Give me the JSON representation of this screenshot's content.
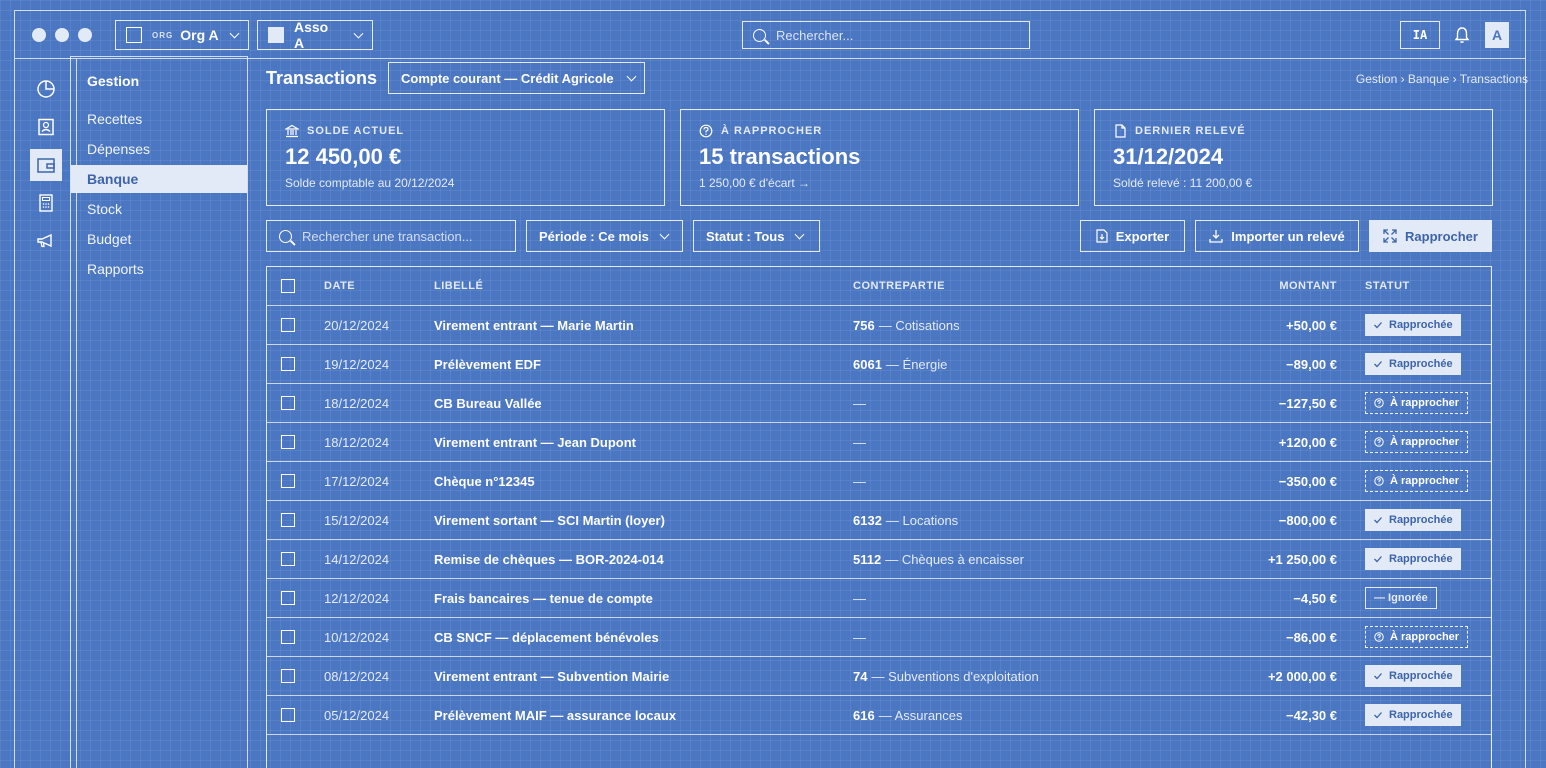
{
  "titlebar": {
    "org_tag": "ORG",
    "org_name": "Org A",
    "asso_name": "Asso A",
    "search_placeholder": "Rechercher...",
    "ia_label": "IA",
    "avatar_letter": "A"
  },
  "rail": {
    "icons": [
      "pie-chart-icon",
      "contact-card-icon",
      "wallet-icon",
      "calculator-icon",
      "megaphone-icon"
    ],
    "active_index": 2
  },
  "submenu": {
    "title": "Gestion",
    "items": [
      "Recettes",
      "Dépenses",
      "Banque",
      "Stock",
      "Budget",
      "Rapports"
    ],
    "active_index": 2
  },
  "header": {
    "title": "Transactions",
    "account": "Compte courant — Crédit Agricole",
    "breadcrumb": "Gestion › Banque › Transactions"
  },
  "cards": [
    {
      "label": "SOLDE ACTUEL",
      "icon": "bank-icon",
      "value": "12 450,00 €",
      "sub": "Solde comptable au 20/12/2024"
    },
    {
      "label": "À RAPPROCHER",
      "icon": "question-circle-icon",
      "value": "15 transactions",
      "sub": "1 250,00 € d'écart →"
    },
    {
      "label": "DERNIER RELEVÉ",
      "icon": "document-icon",
      "value": "31/12/2024",
      "sub": "Soldé relevé : 11 200,00 €"
    }
  ],
  "filters": {
    "search_placeholder": "Rechercher une transaction...",
    "period": "Période : Ce mois",
    "status": "Statut : Tous"
  },
  "actions": {
    "export": "Exporter",
    "import": "Importer un relevé",
    "reconcile": "Rapprocher"
  },
  "table": {
    "headers": {
      "date": "DATE",
      "libelle": "LIBELLÉ",
      "contrepartie": "CONTREPARTIE",
      "montant": "MONTANT",
      "statut": "STATUT"
    },
    "rows": [
      {
        "date": "20/12/2024",
        "libelle": "Virement entrant — Marie Martin",
        "compte": "756",
        "compte_label": "— Cotisations",
        "montant": "+50,00 €",
        "statut": "Rapprochée",
        "kind": "rapprochee"
      },
      {
        "date": "19/12/2024",
        "libelle": "Prélèvement EDF",
        "compte": "6061",
        "compte_label": "— Énergie",
        "montant": "−89,00 €",
        "statut": "Rapprochée",
        "kind": "rapprochee"
      },
      {
        "date": "18/12/2024",
        "libelle": "CB Bureau Vallée",
        "compte": "",
        "compte_label": "—",
        "montant": "−127,50 €",
        "statut": "À rapprocher",
        "kind": "arapprocher"
      },
      {
        "date": "18/12/2024",
        "libelle": "Virement entrant — Jean Dupont",
        "compte": "",
        "compte_label": "—",
        "montant": "+120,00 €",
        "statut": "À rapprocher",
        "kind": "arapprocher"
      },
      {
        "date": "17/12/2024",
        "libelle": "Chèque n°12345",
        "compte": "",
        "compte_label": "—",
        "montant": "−350,00 €",
        "statut": "À rapprocher",
        "kind": "arapprocher"
      },
      {
        "date": "15/12/2024",
        "libelle": "Virement sortant — SCI Martin (loyer)",
        "compte": "6132",
        "compte_label": "— Locations",
        "montant": "−800,00 €",
        "statut": "Rapprochée",
        "kind": "rapprochee"
      },
      {
        "date": "14/12/2024",
        "libelle": "Remise de chèques — BOR-2024-014",
        "compte": "5112",
        "compte_label": "— Chèques à encaisser",
        "montant": "+1 250,00 €",
        "statut": "Rapprochée",
        "kind": "rapprochee"
      },
      {
        "date": "12/12/2024",
        "libelle": "Frais bancaires — tenue de compte",
        "compte": "",
        "compte_label": "—",
        "montant": "−4,50 €",
        "statut": "— Ignorée",
        "kind": "ignoree"
      },
      {
        "date": "10/12/2024",
        "libelle": "CB SNCF — déplacement bénévoles",
        "compte": "",
        "compte_label": "—",
        "montant": "−86,00 €",
        "statut": "À rapprocher",
        "kind": "arapprocher"
      },
      {
        "date": "08/12/2024",
        "libelle": "Virement entrant — Subvention Mairie",
        "compte": "74",
        "compte_label": "— Subventions d'exploitation",
        "montant": "+2 000,00 €",
        "statut": "Rapprochée",
        "kind": "rapprochee"
      },
      {
        "date": "05/12/2024",
        "libelle": "Prélèvement MAIF — assurance locaux",
        "compte": "616",
        "compte_label": "— Assurances",
        "montant": "−42,30 €",
        "statut": "Rapprochée",
        "kind": "rapprochee"
      }
    ]
  },
  "colors": {
    "background": "#4a76c2",
    "accent_fill": "#e3eaf7",
    "accent_text": "#3d64ab",
    "line": "#ffffff"
  }
}
